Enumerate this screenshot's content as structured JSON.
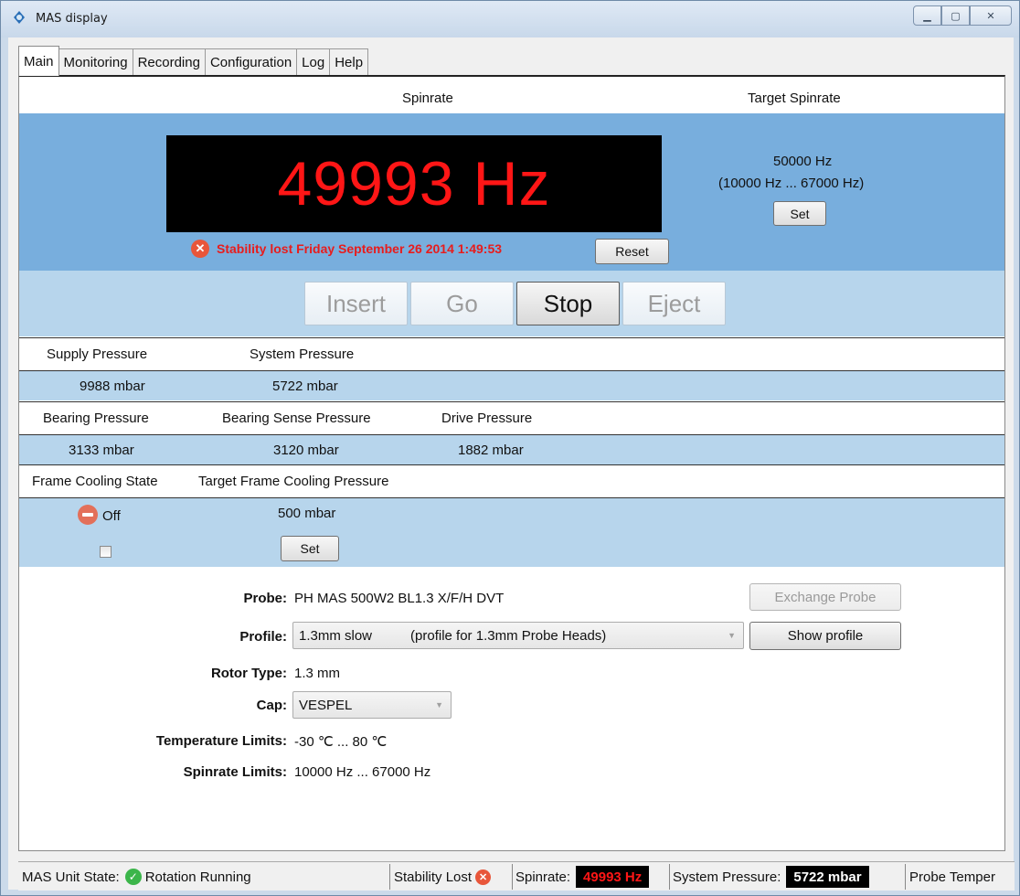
{
  "window": {
    "title": "MAS display"
  },
  "tabs": [
    "Main",
    "Monitoring",
    "Recording",
    "Configuration",
    "Log",
    "Help"
  ],
  "header": {
    "spinrate": "Spinrate",
    "target_spinrate": "Target Spinrate"
  },
  "spinrate": {
    "display": "49993 Hz",
    "target": "50000 Hz",
    "target_range": "(10000 Hz ... 67000 Hz)",
    "set_label": "Set",
    "stability_message": "Stability lost Friday September 26 2014 1:49:53",
    "reset_label": "Reset"
  },
  "actions": {
    "insert": "Insert",
    "go": "Go",
    "stop": "Stop",
    "eject": "Eject"
  },
  "pressures": {
    "supply_label": "Supply Pressure",
    "supply_value": "9988 mbar",
    "system_label": "System Pressure",
    "system_value": "5722 mbar",
    "bearing_label": "Bearing Pressure",
    "bearing_value": "3133 mbar",
    "bearing_sense_label": "Bearing Sense Pressure",
    "bearing_sense_value": "3120 mbar",
    "drive_label": "Drive Pressure",
    "drive_value": "1882 mbar"
  },
  "cooling": {
    "state_label": "Frame Cooling State",
    "target_label": "Target Frame Cooling Pressure",
    "state_value": "Off",
    "target_value": "500 mbar",
    "set_label": "Set",
    "checkbox_checked": false
  },
  "probe": {
    "probe_label": "Probe:",
    "probe_value": "PH MAS 500W2 BL1.3 X/F/H DVT",
    "exchange_label": "Exchange Probe",
    "profile_label": "Profile:",
    "profile_value": "1.3mm slow",
    "profile_desc": "(profile for 1.3mm Probe Heads)",
    "show_profile_label": "Show profile",
    "rotor_label": "Rotor Type:",
    "rotor_value": "1.3 mm",
    "cap_label": "Cap:",
    "cap_value": "VESPEL",
    "temp_label": "Temperature Limits:",
    "temp_value": "-30 ℃ ... 80 ℃",
    "spin_label": "Spinrate Limits:",
    "spin_value": "10000 Hz ... 67000 Hz"
  },
  "statusbar": {
    "unit_state_label": "MAS Unit State:",
    "unit_state_value": "Rotation Running",
    "stability": "Stability Lost",
    "spinrate_label": "Spinrate:",
    "spinrate_value": "49993 Hz",
    "system_pressure_label": "System Pressure:",
    "system_pressure_value": "5722 mbar",
    "probe_temp": "Probe Temper"
  },
  "colors": {
    "display_text": "#ff1616",
    "error": "#e81c1c",
    "blue_dark": "#78aedd",
    "blue_light": "#b7d5ec",
    "ok_green": "#3bb54a"
  },
  "icons": {
    "app": "mas-app-icon",
    "error": "error-x-icon",
    "off": "minus-circle-icon",
    "ok": "check-circle-icon"
  }
}
